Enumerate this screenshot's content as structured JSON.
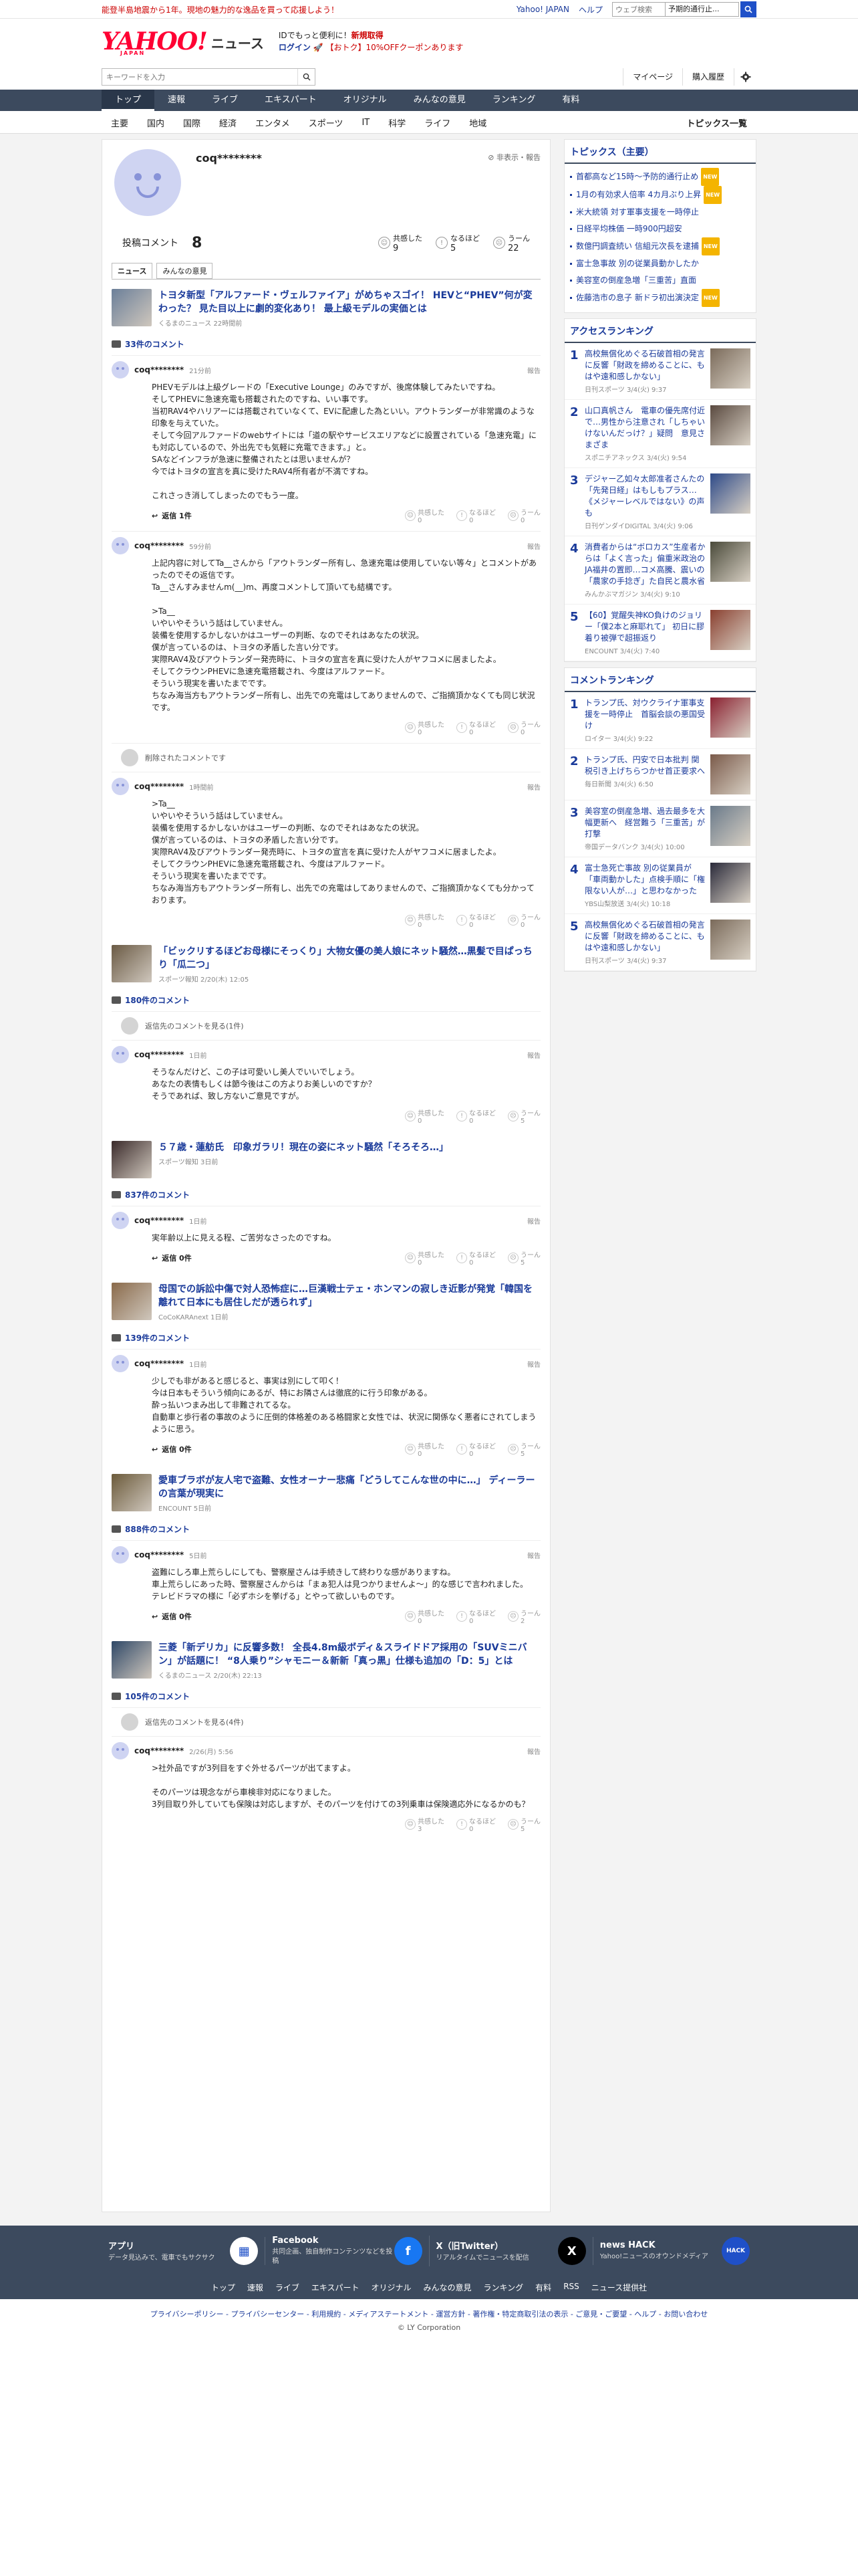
{
  "topbar": {
    "notice": "能登半島地震から1年。現地の魅力的な逸品を買って応援しよう！",
    "links": [
      "Yahoo! JAPAN",
      "ヘルプ"
    ],
    "search_placeholder": "ウェブ検索",
    "search_select": "予期的通行止...",
    "colors": {
      "accent": "#ff0033",
      "nav": "#3c4a5e",
      "link": "#1a3a9a"
    }
  },
  "header": {
    "logo": "YAHOO!",
    "logo_sub": "JAPAN",
    "section": "ニュース",
    "promo_line1_prefix": "IDでもっと便利に",
    "promo_line1_bold": "新規取得",
    "promo_line2_login": "ログイン",
    "promo_line2_rest": "【おトク】10%OFFクーポンあります"
  },
  "search": {
    "placeholder": "キーワードを入力",
    "mypage": "マイページ",
    "history": "購入履歴"
  },
  "nav": {
    "items": [
      "トップ",
      "速報",
      "ライブ",
      "エキスパート",
      "オリジナル",
      "みんなの意見",
      "ランキング",
      "有料"
    ],
    "sub": [
      "主要",
      "国内",
      "国際",
      "経済",
      "エンタメ",
      "スポーツ",
      "IT",
      "科学",
      "ライフ",
      "地域"
    ],
    "sub_right": "トピックス一覧"
  },
  "profile": {
    "username": "coq********",
    "hide_report": "非表示・報告",
    "posted_label": "投稿コメント",
    "posted_count": "8",
    "reactions": [
      {
        "label": "共感した",
        "value": "9"
      },
      {
        "label": "なるほど",
        "value": "5"
      },
      {
        "label": "うーん",
        "value": "22"
      }
    ],
    "tabs": [
      "ニュース",
      "みんなの意見"
    ]
  },
  "common": {
    "report": "報告",
    "r1": "共感した",
    "r2": "なるほど",
    "r3": "うーん",
    "deleted": "削除されたコメントです",
    "see_comments": "返信先のコメントを見る"
  },
  "articles": [
    {
      "title": "トヨタ新型「アルファード・ヴェルファイア」がめちゃスゴイ！ HEVと“PHEV”何が変わった？ 見た目以上に劇的変化あり！ 最上級モデルの実価とは",
      "meta": "くるまのニュース 22時間前",
      "comments_count": "33件のコメント",
      "comments": [
        {
          "user": "coq********",
          "time": "21分前",
          "body": "PHEVモデルは上級グレードの「Executive Lounge」のみですが、後席体験してみたいですね。\nそしてPHEVに急速充電も搭載されたのですね、いい事です。\n当初RAV4やハリアーには搭載されていなくて、EVに配慮した為といい。アウトランダーが非常識のような印象を与えていた。\nそして今回アルファードのwebサイトには「道の駅やサービスエリアなどに設置されている「急速充電」にも対応しているので、外出先でも気軽に充電できます。」と。\nSAなどインフラが急速に整備されたとは思いませんが？\n今ではトヨタの宣言を真に受けたRAV4所有者が不満ですね。\n\nこれさっき消してしまったのでもう一度。",
          "reply": "返信 1件",
          "r": [
            "0",
            "0",
            "0"
          ]
        },
        {
          "user": "coq********",
          "time": "59分前",
          "body": "上記内容に対してTa__さんから「アウトランダー所有し、急速充電は使用していない等々」とコメントがあったのでその返信です。\nTa__さんすみませんm(__)m、再度コメントして頂いても結構です。\n\n>Ta__\nいやいやそういう話はしていません。\n装備を使用するかしないかはユーザーの判断、なのでそれはあなたの状況。\n僕が言っているのは、トヨタの矛盾した言い分です。\n実際RAV4及びアウトランダー発売時に、トヨタの宣言を真に受けた人がヤフコメに居ましたよ。\nそしてクラウンPHEVに急速充電搭載され、今度はアルファード。\nそういう現実を書いたまでです。\nちなみ海当方もアウトランダー所有し、出先での充電はしてありませんので、ご指摘頂かなくても同じ状況です。",
          "reply": "",
          "r": [
            "0",
            "0",
            "0"
          ]
        },
        {
          "deleted": true
        },
        {
          "user": "coq********",
          "time": "1時間前",
          "body": ">Ta__\nいやいやそういう話はしていません。\n装備を使用するかしないかはユーザーの判断、なのでそれはあなたの状況。\n僕が言っているのは、トヨタの矛盾した言い分です。\n実際RAV4及びアウトランダー発売時に、トヨタの宣言を真に受けた人がヤフコメに居ましたよ。\nそしてクラウンPHEVに急速充電搭載され、今度はアルファード。\nそういう現実を書いたまでです。\nちなみ海当方もアウトランダー所有し、出先での充電はしてありませんので、ご指摘頂かなくても分かっております。",
          "reply": "",
          "r": [
            "0",
            "0",
            "0"
          ]
        }
      ]
    },
    {
      "title": "「ビックリするほどお母様にそっくり」大物女優の美人娘にネット騒然…黒髪で目ぱっちり「瓜二つ」",
      "meta": "スポーツ報知 2/20(木) 12:05",
      "comments_count": "180件のコメント",
      "see": "返信先のコメントを見る(1件)",
      "comments": [
        {
          "user": "coq********",
          "time": "1日前",
          "body": "そうなんだけど、この子は可愛いし美人でいいでしょう。\nあなたの表情もしくは節今後はこの方よりお美しいのですか？\nそうであれば、致し方ないご意見ですが。",
          "reply": "",
          "r": [
            "0",
            "0",
            "5"
          ]
        }
      ]
    },
    {
      "title": "５７歳・蓮舫氏　印象ガラリ！現在の姿にネット騒然「そろそろ…」",
      "meta": "スポーツ報知 3日前",
      "comments_count": "837件のコメント",
      "comments": [
        {
          "user": "coq********",
          "time": "1日前",
          "body": "実年齢以上に見える程、ご苦労なさったのですね。",
          "reply": "返信 0件",
          "r": [
            "0",
            "0",
            "5"
          ]
        }
      ]
    },
    {
      "title": "母国での訴訟中傷で対人恐怖症に…巨漢戦士テェ・ホンマンの寂しき近影が発覚「韓国を離れて日本にも居住しだが透られず」",
      "meta": "CoCoKARAnext 1日前",
      "comments_count": "139件のコメント",
      "comments": [
        {
          "user": "coq********",
          "time": "1日前",
          "body": "少しでも非があると感じると、事実は別にして叩く！\n今は日本もそういう傾向にあるが、特にお隣さんは徹底的に行う印象がある。\n酔っ払いつまみ出して非難されてるな。\n自動車と歩行者の事故のように圧倒的体格差のある格闘家と女性では、状況に関係なく悪者にされてしまうように思う。",
          "reply": "返信 0件",
          "r": [
            "0",
            "0",
            "5"
          ]
        }
      ]
    },
    {
      "title": "愛車ブラボが友人宅で盗難、女性オーナー悲痛「どうしてこんな世の中に…」 ディーラーの言葉が現実に",
      "meta": "ENCOUNT 5日前",
      "comments_count": "888件のコメント",
      "comments": [
        {
          "user": "coq********",
          "time": "5日前",
          "body": "盗難にしろ車上荒らしにしても、警察屋さんは手続きして終わりな感がありますね。\n車上荒らしにあった時、警察屋さんからは「まぁ犯人は見つかりませんよ～」的な感じで言われました。\nテレビドラマの様に「必ずホシを挙げる」とやって欲しいものです。",
          "reply": "返信 0件",
          "r": [
            "0",
            "0",
            "2"
          ]
        }
      ]
    },
    {
      "title": "三菱「新デリカ」に反響多数！ 全長4.8m級ボディ＆スライドドア採用の「SUVミニバン」が話題に！ “8人乗り”シャモニー＆新新「真っ黒」仕様も追加の「D：5」とは",
      "meta": "くるまのニュース 2/20(木) 22:13",
      "comments_count": "105件のコメント",
      "see": "返信先のコメントを見る(4件)",
      "comments": [
        {
          "user": "coq********",
          "time": "2/26(月) 5:56",
          "body": ">社外品ですが3列目をすぐ外せるパーツが出てますよ。\n\nそのパーツは現念ながら車検非対応になりました。\n3列目取り外していても保険は対応しますが、そのパーツを付けての3列乗車は保険適応外になるかのも？",
          "reply": "",
          "r": [
            "3",
            "0",
            "5"
          ]
        }
      ]
    }
  ],
  "sidebar": {
    "topics_title": "トピックス（主要）",
    "topics": [
      {
        "t": "首都高など15時〜予防的通行止め",
        "new": true
      },
      {
        "t": "1月の有効求人倍率 4カ月ぶり上昇",
        "new": true
      },
      {
        "t": "米大統領 対す軍事支援を一時停止",
        "new": false
      },
      {
        "t": "日経平均株価 一時900円超安",
        "new": false
      },
      {
        "t": "数億円調査続い 信組元次長を逮捕",
        "new": true
      },
      {
        "t": "富士急事故 別の従業員動かしたか",
        "new": false
      },
      {
        "t": "美容室の倒産急増「三重苦」直面",
        "new": false
      },
      {
        "t": "佐藤浩市の息子 新ドラ初出演決定",
        "new": true
      }
    ],
    "new_label": "NEW",
    "access_title": "アクセスランキング",
    "access": [
      {
        "n": "1",
        "t": "高校無償化めぐる石破首相の発言に反響「財政を締めることに、もはや遠和感しかない」",
        "m": "日刊スポーツ 3/4(火) 9:37"
      },
      {
        "n": "2",
        "t": "山口真帆さん　電車の優先席付近で…男性から注意され「しちゃいけないんだっけ？」疑問　意見さまざま",
        "m": "スポニチアネックス 3/4(火) 9:54"
      },
      {
        "n": "3",
        "t": "デジャー乙如々太郎准者さんたの「先発日経」はもしもプラス…《メジャーレベルではない》の声も",
        "m": "日刊ゲンダイDIGITAL 3/4(火) 9:06"
      },
      {
        "n": "4",
        "t": "消費者からは“ボロカス”生産者からは「よく言った」偏重米政治のJA福井の置即…コメ高騰、震いの「農家の手捻ぎ」た自民と農水省",
        "m": "みんかぶマガジン 3/4(火) 9:10"
      },
      {
        "n": "5",
        "t": "【60】覚醒失神KO負けのジョリー「僕2本と麻耶れて」 初日に膠着り被弾で超振返り",
        "m": "ENCOUNT 3/4(火) 7:40"
      }
    ],
    "comment_title": "コメントランキング",
    "comment": [
      {
        "n": "1",
        "t": "トランプ氏、対ウクライナ軍事支援を一時停止　首脳会談の悪国受け",
        "m": "ロイター 3/4(火) 9:22"
      },
      {
        "n": "2",
        "t": "トランプ氏、円安で日本批判 関税引き上げちらつかせ首正要求へ",
        "m": "毎日新聞 3/4(火) 6:50"
      },
      {
        "n": "3",
        "t": "美容室の倒産急増、過去最多を大幅更新へ　経営難う「三重苦」が打撃",
        "m": "帝国データバンク 3/4(火) 10:00"
      },
      {
        "n": "4",
        "t": "富士急死亡事故 別の従業員が「車両動かした」点検手順に「権限ない人が…」と思わなかった",
        "m": "YBS山梨放送 3/4(火) 10:18"
      },
      {
        "n": "5",
        "t": "高校無償化めぐる石破首相の発言に反響「財政を締めることに、もはや遠和感しかない」",
        "m": "日刊スポーツ 3/4(火) 9:37"
      }
    ]
  },
  "footer": {
    "blocks": [
      {
        "t": "アプリ",
        "d": "データ見込みで、電車でもサクサク",
        "icon": "app-icon"
      },
      {
        "t": "Facebook",
        "d": "共同企画、独自制作コンテンツなどを投稿",
        "icon": "facebook-icon"
      },
      {
        "t": "X（旧Twitter）",
        "d": "リアルタイムでニュースを配信",
        "icon": "x-icon"
      },
      {
        "t": "news HACK",
        "d": "Yahoo!ニュースのオウンドメディア",
        "icon": "newshack-icon"
      }
    ],
    "links": [
      "トップ",
      "速報",
      "ライブ",
      "エキスパート",
      "オリジナル",
      "みんなの意見",
      "ランキング",
      "有料",
      "RSS",
      "ニュース提供社"
    ],
    "legal": "プライバシーポリシー - プライバシーセンター - 利用規約 - メディアステートメント - 運営方針 - 著作権・特定商取引法の表示 - ご意見・ご要望 - ヘルプ - お問い合わせ",
    "copyright": "© LY Corporation"
  }
}
